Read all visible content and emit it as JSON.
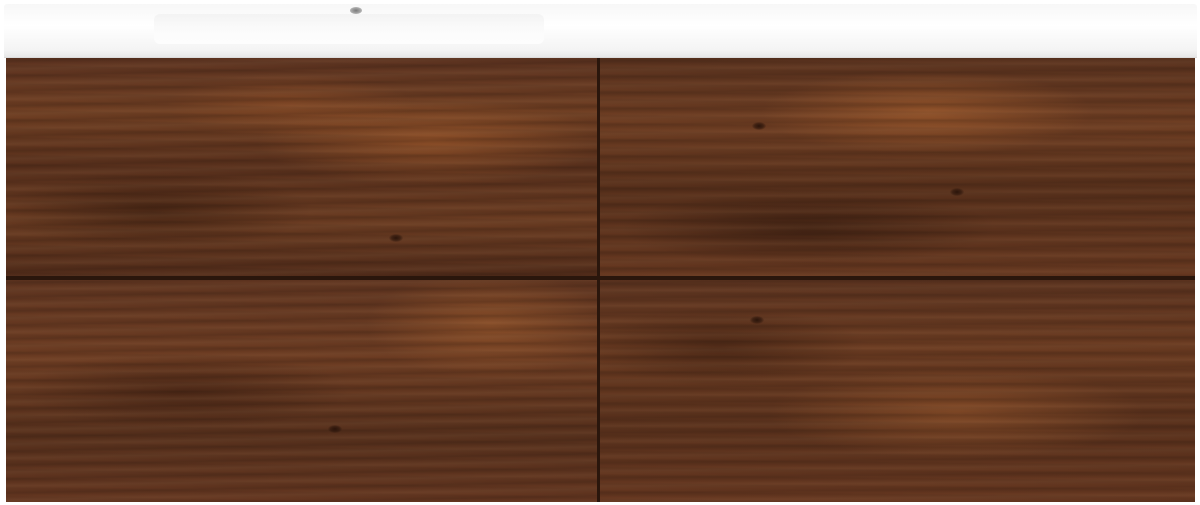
{
  "scene": {
    "subject": "bathroom-vanity-cabinet",
    "countertop_color": "#ffffff",
    "wood_color": "#5d3320",
    "seam_color": "#2a160c",
    "drawers": [
      {
        "id": "top-left"
      },
      {
        "id": "top-right"
      },
      {
        "id": "bottom-left"
      },
      {
        "id": "bottom-right"
      }
    ]
  }
}
